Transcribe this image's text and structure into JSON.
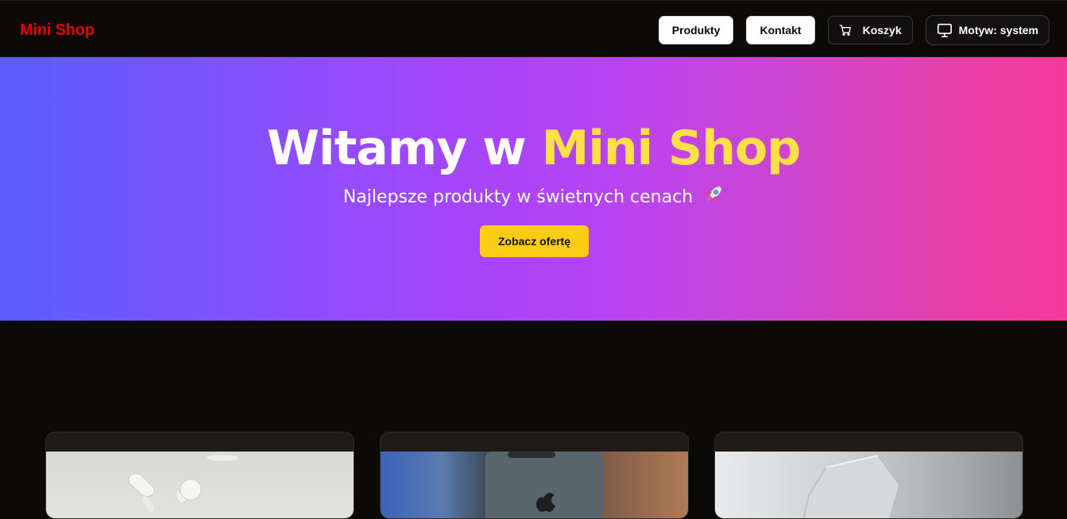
{
  "header": {
    "logo": "Mini Shop",
    "nav": {
      "products": "Produkty",
      "contact": "Kontakt",
      "cart": "Koszyk",
      "theme": "Motyw: system"
    }
  },
  "hero": {
    "title_prefix": "Witamy w ",
    "title_accent": "Mini Shop",
    "subtitle": "Najlepsze produkty w świetnych cenach",
    "cta": "Zobacz ofertę"
  },
  "colors": {
    "brand": "#e10600",
    "accent": "#fde047",
    "cta": "#facc15",
    "gradient_start": "#5b5ffb",
    "gradient_mid": "#a445fb",
    "gradient_end": "#f5389a",
    "background": "#0c0a09"
  },
  "icons": {
    "cart": "cart-icon",
    "theme": "monitor-icon",
    "rocket": "rocket-icon"
  },
  "products": [
    {
      "image": "earbuds-image"
    },
    {
      "image": "phone-image"
    },
    {
      "image": "laptop-image"
    }
  ]
}
